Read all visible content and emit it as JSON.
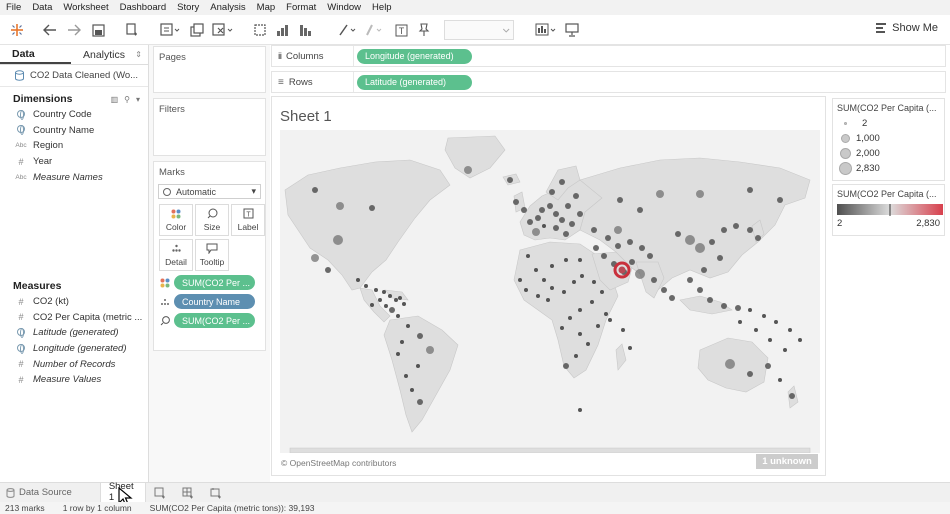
{
  "menu": [
    "File",
    "Data",
    "Worksheet",
    "Dashboard",
    "Story",
    "Analysis",
    "Map",
    "Format",
    "Window",
    "Help"
  ],
  "toolbar": {
    "show_me_label": "Show Me"
  },
  "data_pane": {
    "tabs": [
      "Data",
      "Analytics"
    ],
    "datasource": "CO2 Data Cleaned (Wo...",
    "dimensions_title": "Dimensions",
    "dimensions": [
      {
        "name": "Country Code",
        "type": "geo"
      },
      {
        "name": "Country Name",
        "type": "geo"
      },
      {
        "name": "Region",
        "type": "Abc"
      },
      {
        "name": "Year",
        "type": "#"
      },
      {
        "name": "Measure Names",
        "type": "Abc",
        "italic": true
      }
    ],
    "measures_title": "Measures",
    "measures": [
      {
        "name": "CO2 (kt)",
        "type": "#"
      },
      {
        "name": "CO2 Per Capita (metric ...",
        "type": "#"
      },
      {
        "name": "Latitude (generated)",
        "type": "geo",
        "italic": true
      },
      {
        "name": "Longitude (generated)",
        "type": "geo",
        "italic": true
      },
      {
        "name": "Number of Records",
        "type": "#",
        "italic": true
      },
      {
        "name": "Measure Values",
        "type": "#",
        "italic": true
      }
    ]
  },
  "cards": {
    "pages": "Pages",
    "filters": "Filters",
    "marks": "Marks",
    "mark_type": "Automatic",
    "mark_buttons": [
      "Color",
      "Size",
      "Label",
      "Detail",
      "Tooltip"
    ],
    "mark_pills": [
      "SUM(CO2 Per ...",
      "Country Name",
      "SUM(CO2 Per ..."
    ]
  },
  "shelves": {
    "columns_label": "Columns",
    "columns_pill": "Longitude (generated)",
    "rows_label": "Rows",
    "rows_pill": "Latitude (generated)"
  },
  "sheet": {
    "title": "Sheet 1",
    "attribution": "© OpenStreetMap contributors",
    "unknown": "1 unknown"
  },
  "legends": {
    "size_title": "SUM(CO2 Per Capita (...",
    "size_items": [
      "2",
      "1,000",
      "2,000",
      "2,830"
    ],
    "color_title": "SUM(CO2 Per Capita (...",
    "color_min": "2",
    "color_max": "2,830",
    "colors": {
      "low": "#4f4f4f",
      "mid": "#dcdcdc",
      "high": "#d8404d"
    }
  },
  "tabs": {
    "datasource": "Data Source",
    "sheet": "Sheet 1"
  },
  "status": {
    "marks": "213 marks",
    "layout": "1 row by 1 column",
    "sum": "SUM(CO2 Per Capita (metric tons)): 39,193"
  }
}
